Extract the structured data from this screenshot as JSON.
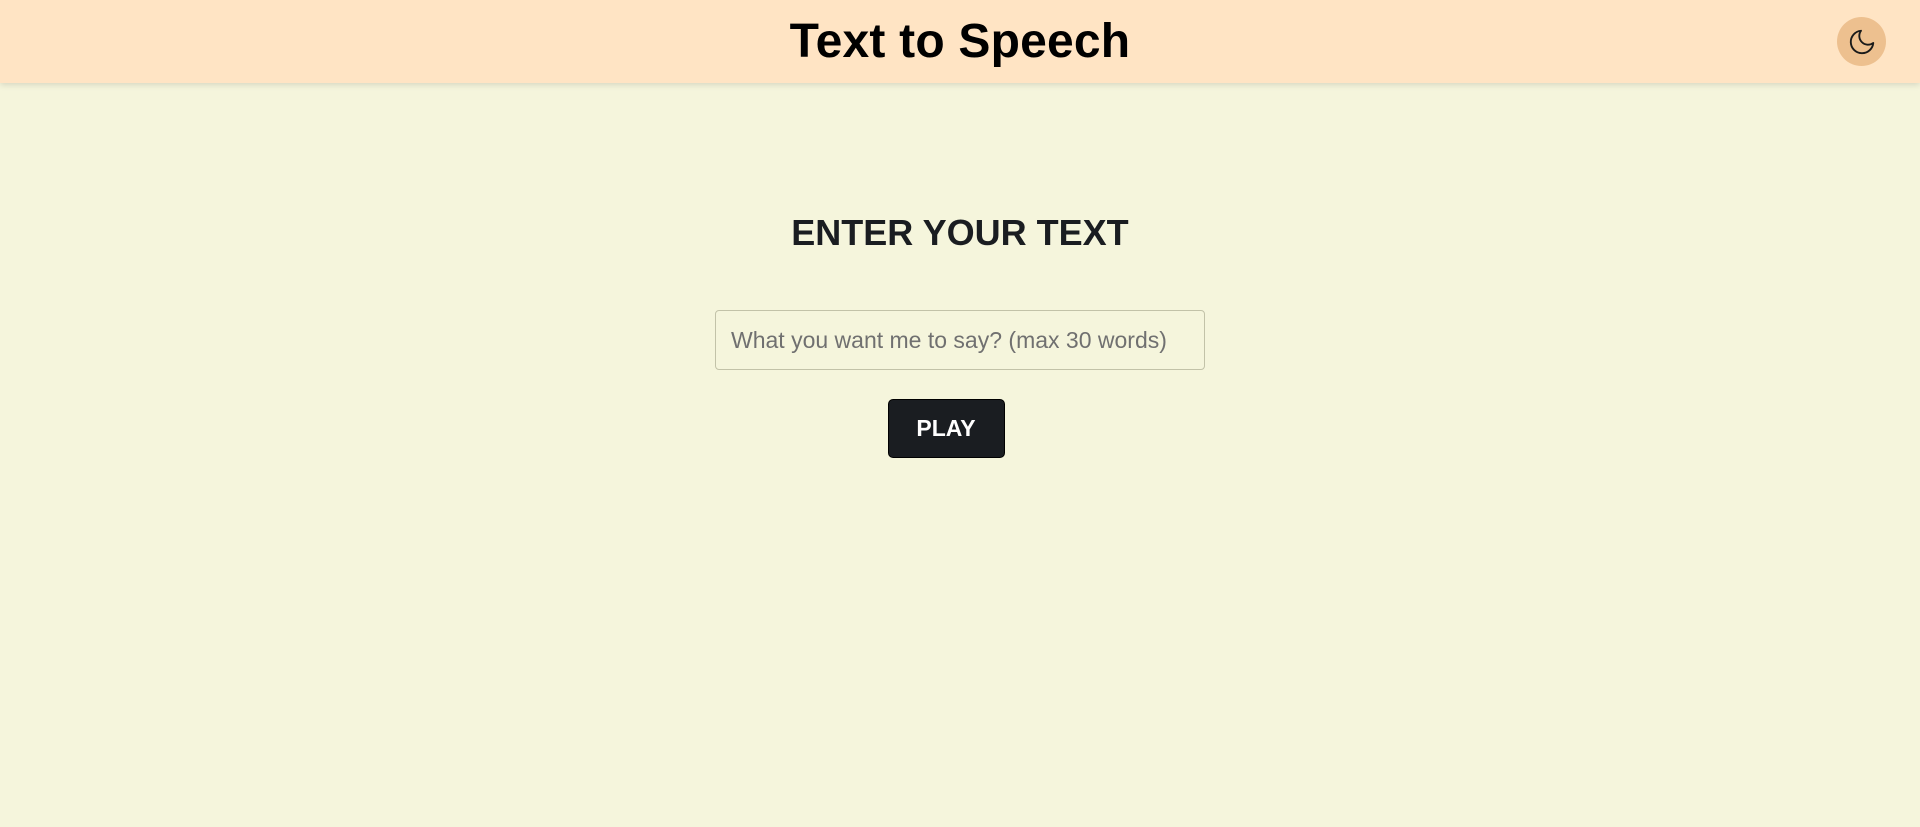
{
  "header": {
    "title": "Text to Speech",
    "theme_toggle_icon": "moon-icon"
  },
  "main": {
    "heading": "ENTER YOUR TEXT",
    "input": {
      "value": "",
      "placeholder": "What you want me to say? (max 30 words)"
    },
    "play_label": "PLAY"
  },
  "colors": {
    "header_bg": "#FFE4C4",
    "page_bg": "#F5F5DC",
    "toggle_bg": "#EDC08F",
    "button_bg": "#1A1D21",
    "button_text": "#FFFFFF"
  }
}
